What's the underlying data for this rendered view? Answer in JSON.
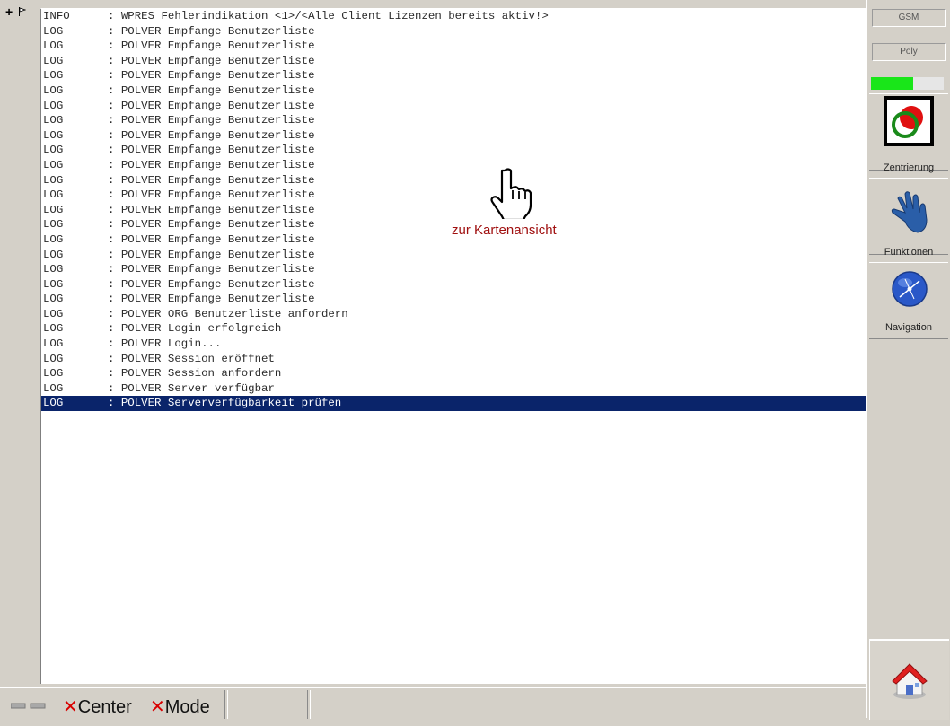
{
  "log": {
    "rows": [
      {
        "level": "INFO",
        "message": ": WPRES Fehlerindikation <1>/<Alle Client Lizenzen bereits aktiv!>"
      },
      {
        "level": "LOG",
        "message": ": POLVER Empfange Benutzerliste"
      },
      {
        "level": "LOG",
        "message": ": POLVER Empfange Benutzerliste"
      },
      {
        "level": "LOG",
        "message": ": POLVER Empfange Benutzerliste"
      },
      {
        "level": "LOG",
        "message": ": POLVER Empfange Benutzerliste"
      },
      {
        "level": "LOG",
        "message": ": POLVER Empfange Benutzerliste"
      },
      {
        "level": "LOG",
        "message": ": POLVER Empfange Benutzerliste"
      },
      {
        "level": "LOG",
        "message": ": POLVER Empfange Benutzerliste"
      },
      {
        "level": "LOG",
        "message": ": POLVER Empfange Benutzerliste"
      },
      {
        "level": "LOG",
        "message": ": POLVER Empfange Benutzerliste"
      },
      {
        "level": "LOG",
        "message": ": POLVER Empfange Benutzerliste"
      },
      {
        "level": "LOG",
        "message": ": POLVER Empfange Benutzerliste"
      },
      {
        "level": "LOG",
        "message": ": POLVER Empfange Benutzerliste"
      },
      {
        "level": "LOG",
        "message": ": POLVER Empfange Benutzerliste"
      },
      {
        "level": "LOG",
        "message": ": POLVER Empfange Benutzerliste"
      },
      {
        "level": "LOG",
        "message": ": POLVER Empfange Benutzerliste"
      },
      {
        "level": "LOG",
        "message": ": POLVER Empfange Benutzerliste"
      },
      {
        "level": "LOG",
        "message": ": POLVER Empfange Benutzerliste"
      },
      {
        "level": "LOG",
        "message": ": POLVER Empfange Benutzerliste"
      },
      {
        "level": "LOG",
        "message": ": POLVER Empfange Benutzerliste"
      },
      {
        "level": "LOG",
        "message": ": POLVER ORG Benutzerliste anfordern"
      },
      {
        "level": "LOG",
        "message": ": POLVER Login erfolgreich"
      },
      {
        "level": "LOG",
        "message": ": POLVER Login..."
      },
      {
        "level": "LOG",
        "message": ": POLVER Session eröffnet"
      },
      {
        "level": "LOG",
        "message": ": POLVER Session anfordern"
      },
      {
        "level": "LOG",
        "message": ": POLVER Server verfügbar"
      },
      {
        "level": "LOG",
        "message": ": POLVER Serververfügbarkeit prüfen",
        "selected": true
      }
    ]
  },
  "overlay": {
    "label": "zur Kartenansicht",
    "icon": "hand-pointer-icon"
  },
  "right_panel": {
    "status_gsm": "GSM",
    "status_poly": "Poly",
    "signal_level": 0.58,
    "signal_color": "#19e619",
    "buttons": [
      {
        "label": "Zentrierung",
        "icon": "overlapping-circles-icon"
      },
      {
        "label": "Funktionen",
        "icon": "pointing-hand-icon"
      },
      {
        "label": "Navigation",
        "icon": "globe-compass-icon"
      }
    ],
    "home_icon": "home-icon"
  },
  "bottom_bar": {
    "center_label": "Center",
    "mode_label": "Mode"
  },
  "colors": {
    "selection": "#0a246a",
    "overlay_text": "#a01010",
    "close_x": "#d80000"
  }
}
